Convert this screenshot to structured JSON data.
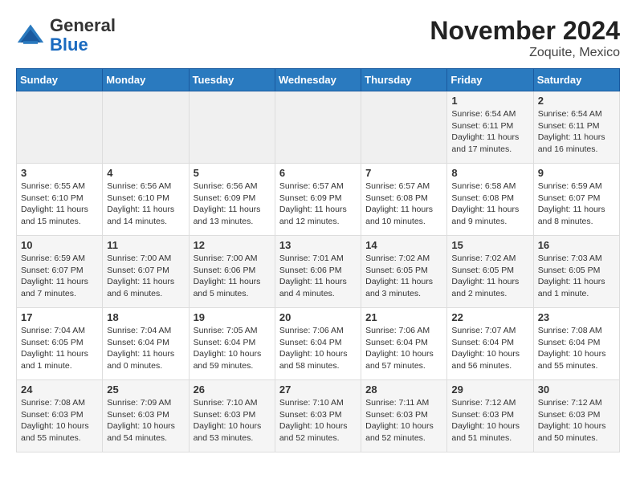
{
  "header": {
    "logo": {
      "general": "General",
      "blue": "Blue"
    },
    "title": "November 2024",
    "location": "Zoquite, Mexico"
  },
  "days_of_week": [
    "Sunday",
    "Monday",
    "Tuesday",
    "Wednesday",
    "Thursday",
    "Friday",
    "Saturday"
  ],
  "weeks": [
    [
      {
        "day": "",
        "empty": true
      },
      {
        "day": "",
        "empty": true
      },
      {
        "day": "",
        "empty": true
      },
      {
        "day": "",
        "empty": true
      },
      {
        "day": "",
        "empty": true
      },
      {
        "day": "1",
        "sunrise": "6:54 AM",
        "sunset": "6:11 PM",
        "daylight": "11 hours and 17 minutes."
      },
      {
        "day": "2",
        "sunrise": "6:54 AM",
        "sunset": "6:11 PM",
        "daylight": "11 hours and 16 minutes."
      }
    ],
    [
      {
        "day": "3",
        "sunrise": "6:55 AM",
        "sunset": "6:10 PM",
        "daylight": "11 hours and 15 minutes."
      },
      {
        "day": "4",
        "sunrise": "6:56 AM",
        "sunset": "6:10 PM",
        "daylight": "11 hours and 14 minutes."
      },
      {
        "day": "5",
        "sunrise": "6:56 AM",
        "sunset": "6:09 PM",
        "daylight": "11 hours and 13 minutes."
      },
      {
        "day": "6",
        "sunrise": "6:57 AM",
        "sunset": "6:09 PM",
        "daylight": "11 hours and 12 minutes."
      },
      {
        "day": "7",
        "sunrise": "6:57 AM",
        "sunset": "6:08 PM",
        "daylight": "11 hours and 10 minutes."
      },
      {
        "day": "8",
        "sunrise": "6:58 AM",
        "sunset": "6:08 PM",
        "daylight": "11 hours and 9 minutes."
      },
      {
        "day": "9",
        "sunrise": "6:59 AM",
        "sunset": "6:07 PM",
        "daylight": "11 hours and 8 minutes."
      }
    ],
    [
      {
        "day": "10",
        "sunrise": "6:59 AM",
        "sunset": "6:07 PM",
        "daylight": "11 hours and 7 minutes."
      },
      {
        "day": "11",
        "sunrise": "7:00 AM",
        "sunset": "6:07 PM",
        "daylight": "11 hours and 6 minutes."
      },
      {
        "day": "12",
        "sunrise": "7:00 AM",
        "sunset": "6:06 PM",
        "daylight": "11 hours and 5 minutes."
      },
      {
        "day": "13",
        "sunrise": "7:01 AM",
        "sunset": "6:06 PM",
        "daylight": "11 hours and 4 minutes."
      },
      {
        "day": "14",
        "sunrise": "7:02 AM",
        "sunset": "6:05 PM",
        "daylight": "11 hours and 3 minutes."
      },
      {
        "day": "15",
        "sunrise": "7:02 AM",
        "sunset": "6:05 PM",
        "daylight": "11 hours and 2 minutes."
      },
      {
        "day": "16",
        "sunrise": "7:03 AM",
        "sunset": "6:05 PM",
        "daylight": "11 hours and 1 minute."
      }
    ],
    [
      {
        "day": "17",
        "sunrise": "7:04 AM",
        "sunset": "6:05 PM",
        "daylight": "11 hours and 1 minute."
      },
      {
        "day": "18",
        "sunrise": "7:04 AM",
        "sunset": "6:04 PM",
        "daylight": "11 hours and 0 minutes."
      },
      {
        "day": "19",
        "sunrise": "7:05 AM",
        "sunset": "6:04 PM",
        "daylight": "10 hours and 59 minutes."
      },
      {
        "day": "20",
        "sunrise": "7:06 AM",
        "sunset": "6:04 PM",
        "daylight": "10 hours and 58 minutes."
      },
      {
        "day": "21",
        "sunrise": "7:06 AM",
        "sunset": "6:04 PM",
        "daylight": "10 hours and 57 minutes."
      },
      {
        "day": "22",
        "sunrise": "7:07 AM",
        "sunset": "6:04 PM",
        "daylight": "10 hours and 56 minutes."
      },
      {
        "day": "23",
        "sunrise": "7:08 AM",
        "sunset": "6:04 PM",
        "daylight": "10 hours and 55 minutes."
      }
    ],
    [
      {
        "day": "24",
        "sunrise": "7:08 AM",
        "sunset": "6:03 PM",
        "daylight": "10 hours and 55 minutes."
      },
      {
        "day": "25",
        "sunrise": "7:09 AM",
        "sunset": "6:03 PM",
        "daylight": "10 hours and 54 minutes."
      },
      {
        "day": "26",
        "sunrise": "7:10 AM",
        "sunset": "6:03 PM",
        "daylight": "10 hours and 53 minutes."
      },
      {
        "day": "27",
        "sunrise": "7:10 AM",
        "sunset": "6:03 PM",
        "daylight": "10 hours and 52 minutes."
      },
      {
        "day": "28",
        "sunrise": "7:11 AM",
        "sunset": "6:03 PM",
        "daylight": "10 hours and 52 minutes."
      },
      {
        "day": "29",
        "sunrise": "7:12 AM",
        "sunset": "6:03 PM",
        "daylight": "10 hours and 51 minutes."
      },
      {
        "day": "30",
        "sunrise": "7:12 AM",
        "sunset": "6:03 PM",
        "daylight": "10 hours and 50 minutes."
      }
    ]
  ]
}
